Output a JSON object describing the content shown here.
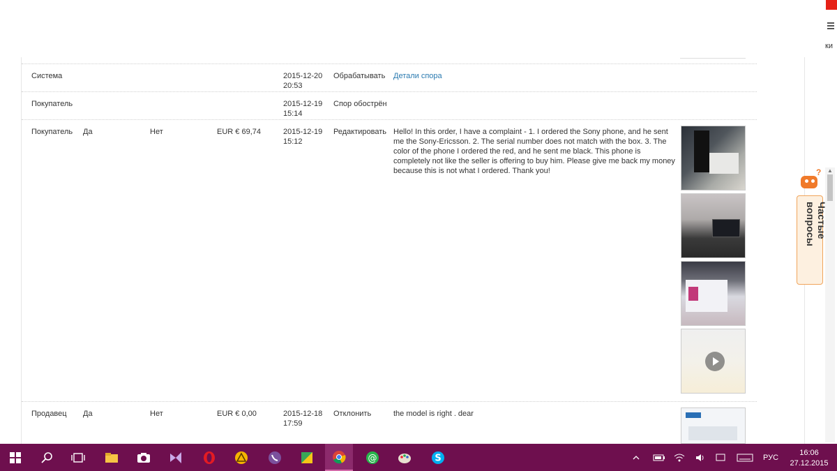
{
  "browser": {
    "right_label": "ки"
  },
  "rows": [
    {
      "role": "Система",
      "yes": "",
      "no": "",
      "sum": "",
      "date": "2015-12-20",
      "time": "20:53",
      "action": "Обрабатывать",
      "desc": "",
      "link": "Детали спора"
    },
    {
      "role": "Покупатель",
      "yes": "",
      "no": "",
      "sum": "",
      "date": "2015-12-19",
      "time": "15:14",
      "action": "Спор обострён",
      "desc": "",
      "link": ""
    },
    {
      "role": "Покупатель",
      "yes": "Да",
      "no": "Нет",
      "sum": "EUR € 69,74",
      "date": "2015-12-19",
      "time": "15:12",
      "action": "Редактировать",
      "desc": "Hello! In this order, I have a complaint - 1. I ordered the Sony phone, and he sent me the Sony-Ericsson. 2. The serial number does not match with the box. 3. The color of the phone I ordered the red, and he sent me black. This phone is completely not like the seller is offering to buy him. Please give me back my money because this is not what I ordered. Thank you!",
      "link": ""
    },
    {
      "role": "Продавец",
      "yes": "Да",
      "no": "Нет",
      "sum": "EUR € 0,00",
      "date": "2015-12-18",
      "time": "17:59",
      "action": "Отклонить",
      "desc": "the model is right . dear",
      "link": ""
    }
  ],
  "faq": {
    "label": "Частые вопросы",
    "badge": "?"
  },
  "taskbar": {
    "lang": "РУС",
    "time": "16:06",
    "date": "27.12.2015"
  },
  "colors": {
    "link": "#2a7ab0",
    "taskbar": "#6e0f4e",
    "faq_accent": "#f07a2a"
  }
}
